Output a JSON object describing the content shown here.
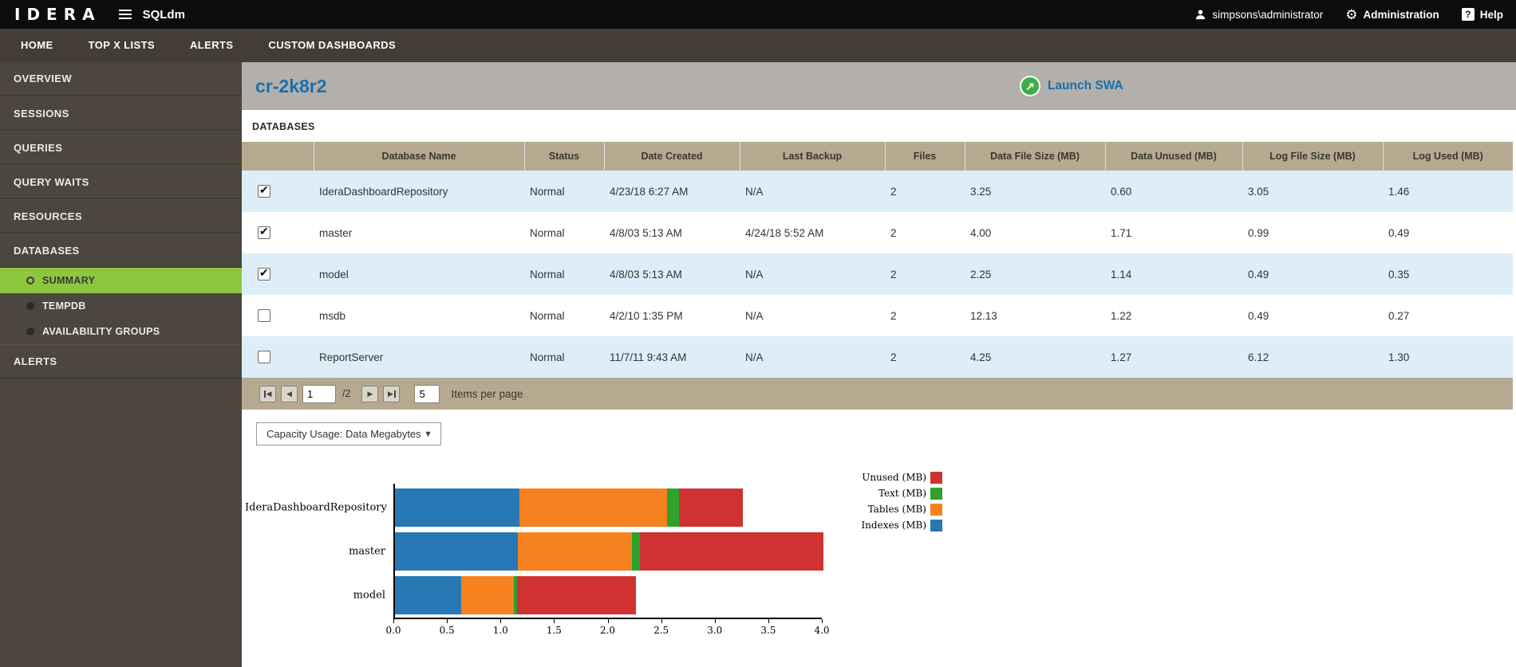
{
  "topbar": {
    "brand": "IDERA",
    "app_name": "SQLdm",
    "user": "simpsons\\administrator",
    "administration_label": "Administration",
    "help_label": "Help"
  },
  "nav": {
    "items": [
      "HOME",
      "TOP X LISTS",
      "ALERTS",
      "CUSTOM DASHBOARDS"
    ]
  },
  "sidebar": {
    "items": [
      {
        "label": "OVERVIEW",
        "type": "item"
      },
      {
        "label": "SESSIONS",
        "type": "item"
      },
      {
        "label": "QUERIES",
        "type": "item"
      },
      {
        "label": "QUERY WAITS",
        "type": "item"
      },
      {
        "label": "RESOURCES",
        "type": "item"
      },
      {
        "label": "DATABASES",
        "type": "item",
        "expanded": true
      },
      {
        "label": "SUMMARY",
        "type": "sub",
        "active": true
      },
      {
        "label": "TEMPDB",
        "type": "sub"
      },
      {
        "label": "AVAILABILITY GROUPS",
        "type": "sub"
      },
      {
        "label": "ALERTS",
        "type": "item"
      }
    ]
  },
  "page": {
    "title": "cr-2k8r2",
    "launch_swa_label": "Launch SWA",
    "section_label": "DATABASES"
  },
  "table": {
    "headers": [
      "Database Name",
      "Status",
      "Date Created",
      "Last Backup",
      "Files",
      "Data File Size (MB)",
      "Data Unused (MB)",
      "Log File Size (MB)",
      "Log Used (MB)"
    ],
    "rows": [
      {
        "checked": true,
        "cells": [
          "IderaDashboardRepository",
          "Normal",
          "4/23/18 6:27 AM",
          "N/A",
          "2",
          "3.25",
          "0.60",
          "3.05",
          "1.46"
        ]
      },
      {
        "checked": true,
        "cells": [
          "master",
          "Normal",
          "4/8/03 5:13 AM",
          "4/24/18 5:52 AM",
          "2",
          "4.00",
          "1.71",
          "0.99",
          "0.49"
        ]
      },
      {
        "checked": true,
        "cells": [
          "model",
          "Normal",
          "4/8/03 5:13 AM",
          "N/A",
          "2",
          "2.25",
          "1.14",
          "0.49",
          "0.35"
        ]
      },
      {
        "checked": false,
        "cells": [
          "msdb",
          "Normal",
          "4/2/10 1:35 PM",
          "N/A",
          "2",
          "12.13",
          "1.22",
          "0.49",
          "0.27"
        ]
      },
      {
        "checked": false,
        "cells": [
          "ReportServer",
          "Normal",
          "11/7/11 9:43 AM",
          "N/A",
          "2",
          "4.25",
          "1.27",
          "6.12",
          "1.30"
        ]
      }
    ]
  },
  "pagination": {
    "page_value": "1",
    "page_total": "/2",
    "items_per_page_value": "5",
    "items_per_page_label": "Items per page"
  },
  "capacity_dropdown": {
    "selected": "Capacity Usage: Data Megabytes"
  },
  "colors": {
    "accent_green": "#8dc63f",
    "title_blue": "#1a6fad",
    "table_header_tan": "#b5aa90",
    "row_highlight_blue": "#ddeef8",
    "launch_icon_green": "#3fae49"
  },
  "chart_data": {
    "type": "bar",
    "orientation": "horizontal",
    "stacked": true,
    "title": "",
    "xlabel": "",
    "ylabel": "",
    "categories": [
      "IderaDashboardRepository",
      "master",
      "model"
    ],
    "series": [
      {
        "name": "Indexes (MB)",
        "color": "#2878b5",
        "values": [
          1.16,
          1.15,
          0.62
        ]
      },
      {
        "name": "Tables (MB)",
        "color": "#f5821f",
        "values": [
          1.38,
          1.06,
          0.49
        ]
      },
      {
        "name": "Text (MB)",
        "color": "#2fa12d",
        "values": [
          0.11,
          0.08,
          0.03
        ]
      },
      {
        "name": "Unused (MB)",
        "color": "#d03232",
        "values": [
          0.6,
          1.71,
          1.11
        ]
      }
    ],
    "xlim": [
      0,
      4
    ],
    "xticks": [
      0,
      0.5,
      1,
      1.5,
      2,
      2.5,
      3,
      3.5,
      4
    ],
    "grid": false,
    "legend_position": "top-right",
    "legend_order": [
      "Unused (MB)",
      "Text (MB)",
      "Tables (MB)",
      "Indexes (MB)"
    ]
  }
}
